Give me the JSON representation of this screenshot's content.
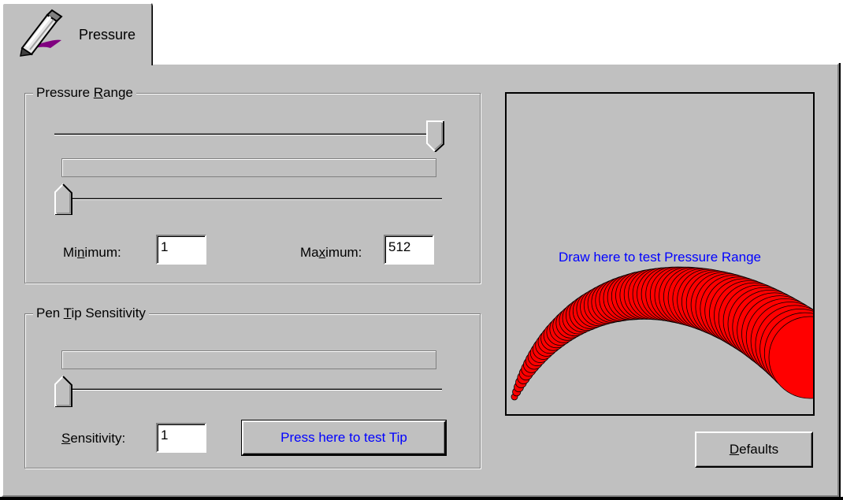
{
  "tab": {
    "label": "Pressure"
  },
  "pressure_range": {
    "title_pre": "Pressure ",
    "title_mnemonic": "R",
    "title_post": "ange",
    "minimum": {
      "label_pre": "Mi",
      "label_mnemonic": "n",
      "label_post": "imum:",
      "value": "1"
    },
    "maximum": {
      "label_pre": "Ma",
      "label_mnemonic": "x",
      "label_post": "imum:",
      "value": "512"
    },
    "slider_max_level": 1.0,
    "slider_min_level": 0.0
  },
  "tip_sensitivity": {
    "title_pre": "Pen ",
    "title_mnemonic": "T",
    "title_post": "ip Sensitivity",
    "sensitivity": {
      "label_mnemonic": "S",
      "label_post": "ensitivity:",
      "value": "1"
    },
    "slider_level": 0.0,
    "test_button": "Press here to test Tip"
  },
  "draw_area": {
    "prompt": "Draw here to test Pressure Range"
  },
  "defaults_button": {
    "mnemonic": "D",
    "rest": "efaults"
  },
  "colors": {
    "face": "#c0c0c0",
    "accent_text": "#0000ff",
    "stroke": "#ff0000"
  }
}
